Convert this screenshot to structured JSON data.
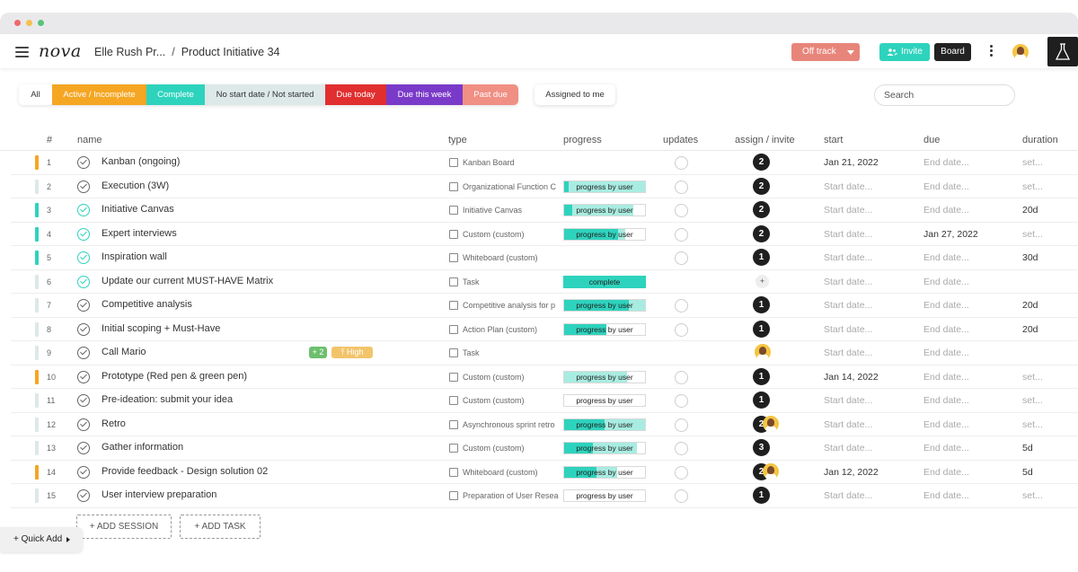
{
  "header": {
    "logo": "nova",
    "breadcrumb_workspace": "Elle Rush Pr...",
    "breadcrumb_sep": "/",
    "breadcrumb_page": "Product Initiative 34",
    "status_label": "Off track",
    "invite_label": "Invite",
    "board_label": "Board"
  },
  "filters": {
    "all": "All",
    "active": "Active / Incomplete",
    "complete": "Complete",
    "no_start": "No start date / Not started",
    "due_today": "Due today",
    "due_week": "Due this week",
    "past_due": "Past due",
    "assigned": "Assigned to me"
  },
  "search": {
    "placeholder": "Search"
  },
  "columns": {
    "num": "#",
    "name": "name",
    "type": "type",
    "progress": "progress",
    "updates": "updates",
    "assign": "assign / invite",
    "start": "start",
    "due": "due",
    "duration": "duration"
  },
  "colors": {
    "orange": "#f5a623",
    "teal": "#2ed3bd",
    "pale": "#dde8e9",
    "red": "#e12f2f",
    "purple": "#7a3ac9",
    "salmon": "#f08f84"
  },
  "rows": [
    {
      "num": "1",
      "name": "Kanban (ongoing)",
      "type": "Kanban Board",
      "bar": "orange",
      "done": false,
      "progress": "",
      "progress_fill": 0,
      "progress_light": 0,
      "assign": "2",
      "start": "Jan 21, 2022",
      "due": "End date...",
      "duration": "set..."
    },
    {
      "num": "2",
      "name": "Execution (3W)",
      "type": "Organizational Function C",
      "bar": "pale",
      "done": false,
      "progress": "progress by user",
      "progress_fill": 0.05,
      "progress_light": 1.0,
      "assign": "2",
      "start": "Start date...",
      "due": "End date...",
      "duration": "set..."
    },
    {
      "num": "3",
      "name": "Initiative Canvas",
      "type": "Initiative Canvas",
      "bar": "teal",
      "done": true,
      "progress": "progress by user",
      "progress_fill": 0.1,
      "progress_light": 0.85,
      "assign": "2",
      "start": "Start date...",
      "due": "End date...",
      "duration": "20d"
    },
    {
      "num": "4",
      "name": "Expert interviews",
      "type": "Custom (custom)",
      "bar": "teal",
      "done": true,
      "progress": "progress by user",
      "progress_fill": 0.67,
      "progress_light": 0.75,
      "assign": "2",
      "start": "Start date...",
      "due": "Jan 27, 2022",
      "duration": "set..."
    },
    {
      "num": "5",
      "name": "Inspiration wall",
      "type": "Whiteboard (custom)",
      "bar": "teal",
      "done": true,
      "progress": "",
      "progress_fill": 0,
      "progress_light": 0,
      "assign": "1",
      "start": "Start date...",
      "due": "End date...",
      "duration": "30d"
    },
    {
      "num": "6",
      "name": "Update our current MUST-HAVE Matrix",
      "type": "Task",
      "bar": "pale",
      "done": true,
      "progress": "complete",
      "progress_fill": 1.0,
      "progress_light": 0,
      "assign": "",
      "start": "Start date...",
      "due": "End date...",
      "duration": ""
    },
    {
      "num": "7",
      "name": "Competitive analysis",
      "type": "Competitive analysis for p",
      "bar": "pale",
      "done": false,
      "progress": "progress by user",
      "progress_fill": 0.8,
      "progress_light": 1.0,
      "assign": "1",
      "start": "Start date...",
      "due": "End date...",
      "duration": "20d"
    },
    {
      "num": "8",
      "name": "Initial scoping + Must-Have",
      "type": "Action Plan (custom)",
      "bar": "pale",
      "done": false,
      "progress": "progress by user",
      "progress_fill": 0.52,
      "progress_light": 0,
      "assign": "1",
      "start": "Start date...",
      "due": "End date...",
      "duration": "20d"
    },
    {
      "num": "9",
      "name": "Call Mario",
      "type": "Task",
      "bar": "pale",
      "done": false,
      "progress": "",
      "progress_fill": 0,
      "progress_light": 0,
      "assign": "",
      "tag_plus": "+ 2",
      "tag_high": "⤒ High",
      "start": "Start date...",
      "due": "End date...",
      "duration": ""
    },
    {
      "num": "10",
      "name": "Prototype (Red pen & green pen)",
      "type": "Custom (custom)",
      "bar": "orange",
      "done": false,
      "progress": "progress by user",
      "progress_fill": 0,
      "progress_light": 0.78,
      "assign": "1",
      "start": "Jan 14, 2022",
      "due": "End date...",
      "duration": "set..."
    },
    {
      "num": "11",
      "name": "Pre-ideation: submit your idea",
      "type": "Custom (custom)",
      "bar": "pale",
      "done": false,
      "progress": "progress by user",
      "progress_fill": 0,
      "progress_light": 0,
      "assign": "1",
      "start": "Start date...",
      "due": "End date...",
      "duration": "set..."
    },
    {
      "num": "12",
      "name": "Retro",
      "type": "Asynchronous sprint retro",
      "bar": "pale",
      "done": false,
      "progress": "progress by user",
      "progress_fill": 0.5,
      "progress_light": 1.0,
      "assign": "2",
      "start": "Start date...",
      "due": "End date...",
      "duration": "set..."
    },
    {
      "num": "13",
      "name": "Gather information",
      "type": "Custom (custom)",
      "bar": "pale",
      "done": false,
      "progress": "progress by user",
      "progress_fill": 0.35,
      "progress_light": 0.9,
      "assign": "3",
      "start": "Start date...",
      "due": "End date...",
      "duration": "5d"
    },
    {
      "num": "14",
      "name": "Provide feedback - Design solution 02",
      "type": "Whiteboard (custom)",
      "bar": "orange",
      "done": false,
      "progress": "progress by user",
      "progress_fill": 0.4,
      "progress_light": 0.65,
      "assign": "2",
      "start": "Jan 12, 2022",
      "due": "End date...",
      "duration": "5d"
    },
    {
      "num": "15",
      "name": "User interview preparation",
      "type": "Preparation of User Resea",
      "bar": "pale",
      "done": false,
      "progress": "progress by user",
      "progress_fill": 0,
      "progress_light": 0,
      "assign": "1",
      "start": "Start date...",
      "due": "End date...",
      "duration": "set..."
    }
  ],
  "actions": {
    "add_session": "+ ADD SESSION",
    "add_task": "+ ADD TASK",
    "quick_add": "+ Quick Add"
  }
}
